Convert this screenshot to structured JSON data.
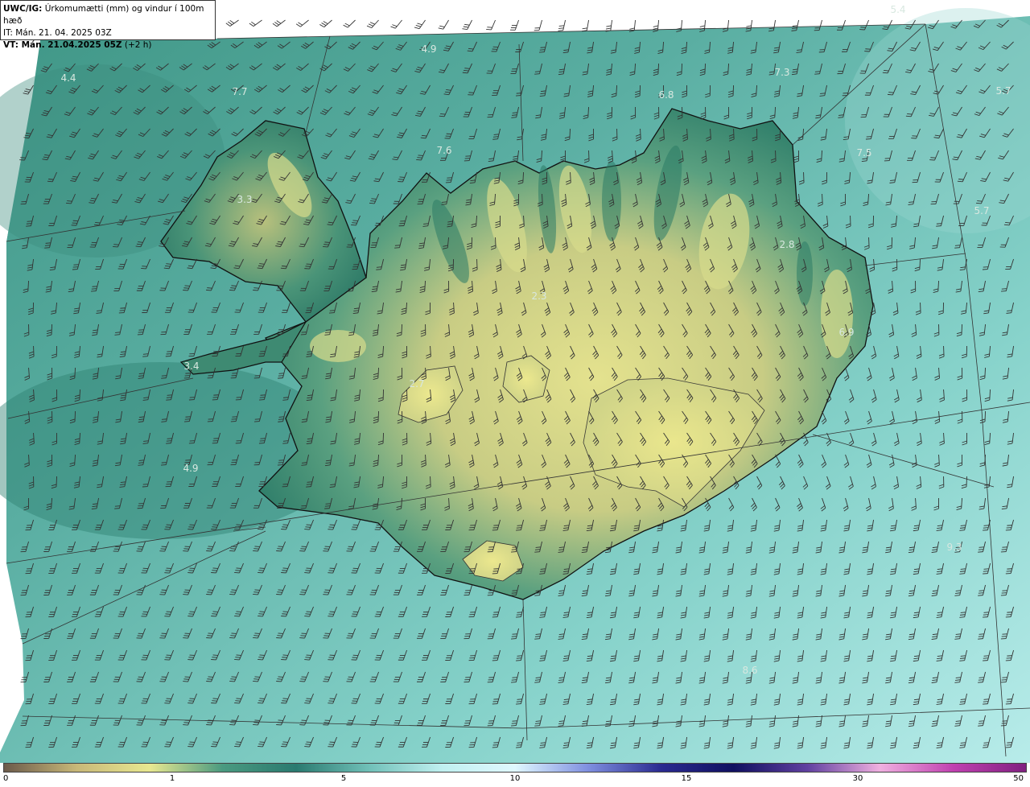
{
  "header": {
    "title_prefix": "UWC/IG:",
    "title_rest": " Úrkomumætti (mm) og vindur í 100m hæð",
    "it_line": "IT: Mán. 21. 04. 2025 03Z",
    "vt_prefix": "VT: Mán. 21.04.2025 05Z",
    "vt_suffix": " (+2 h)"
  },
  "value_labels": [
    {
      "text": "5.4"
    },
    {
      "text": "4.9"
    },
    {
      "text": "4.4"
    },
    {
      "text": "7.3"
    },
    {
      "text": "6.8"
    },
    {
      "text": "5.7"
    },
    {
      "text": "7.7"
    },
    {
      "text": "7.6"
    },
    {
      "text": "7.5"
    },
    {
      "text": "3.3"
    },
    {
      "text": "5.7"
    },
    {
      "text": "2.8"
    },
    {
      "text": "2.3"
    },
    {
      "text": "6.9"
    },
    {
      "text": "3.4"
    },
    {
      "text": "2.7"
    },
    {
      "text": "4.9"
    },
    {
      "text": "9.3"
    },
    {
      "text": "8.6"
    }
  ],
  "colorbar": {
    "ticks": [
      "0",
      "1",
      "5",
      "10",
      "15",
      "30",
      "50"
    ],
    "colors": [
      "#6b5a4a",
      "#c8b878",
      "#e8e890",
      "#4a9a80",
      "#2a7a70",
      "#70c0b8",
      "#c0f0f0",
      "#e0f8ff",
      "#8090e0",
      "#2a2a90",
      "#101060",
      "#6040a0",
      "#f0b0e0",
      "#c040b0",
      "#802080"
    ]
  },
  "colors": {
    "ocean_light": "#8ed8d4",
    "ocean_mid": "#5ab0a4",
    "land_low": "#3a8a72",
    "land_high": "#e0e08a",
    "coast": "#111111",
    "grid": "#333333",
    "barb": "#333333"
  }
}
